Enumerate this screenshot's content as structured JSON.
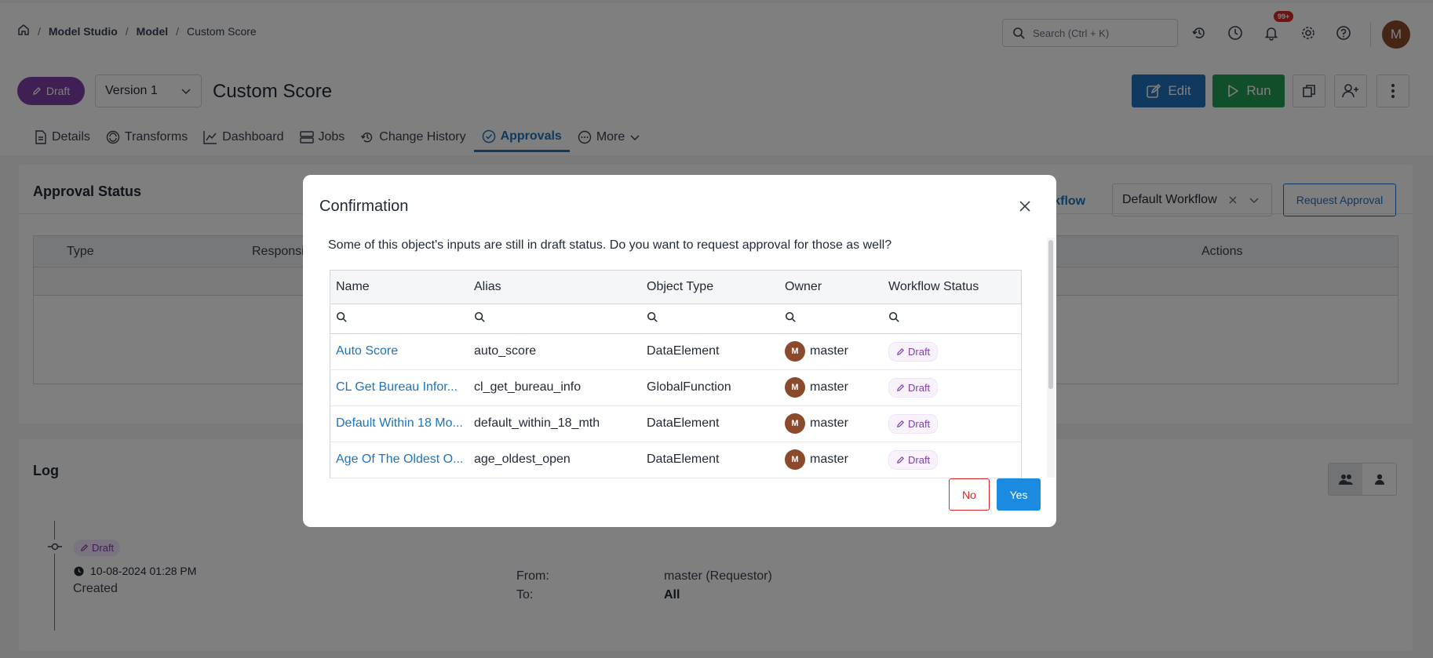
{
  "breadcrumb": {
    "home_icon": "home-icon",
    "items": [
      "Model Studio",
      "Model"
    ],
    "current": "Custom Score"
  },
  "search": {
    "placeholder": "Search (Ctrl + K)"
  },
  "notifications": {
    "badge": "99+"
  },
  "user": {
    "initial": "M"
  },
  "header": {
    "status": "Draft",
    "version": "Version 1",
    "title": "Custom Score",
    "edit_label": "Edit",
    "run_label": "Run"
  },
  "tabs": [
    {
      "label": "Details",
      "icon": "document-icon"
    },
    {
      "label": "Transforms",
      "icon": "transform-icon"
    },
    {
      "label": "Dashboard",
      "icon": "chart-icon"
    },
    {
      "label": "Jobs",
      "icon": "server-icon"
    },
    {
      "label": "Change History",
      "icon": "history-icon"
    },
    {
      "label": "Approvals",
      "icon": "check-circle-icon"
    },
    {
      "label": "More",
      "icon": "ellipsis-icon"
    }
  ],
  "approval": {
    "title": "Approval Status",
    "workflow_link": "rkflow",
    "workflow_select": "Default Workflow",
    "request_button": "Request Approval",
    "columns": {
      "type": "Type",
      "response": "Responsi",
      "actions": "Actions"
    }
  },
  "log": {
    "title": "Log",
    "status": "Draft",
    "timestamp": "10-08-2024 01:28 PM",
    "action": "Created",
    "from_label": "From:",
    "from_value": "master (Requestor)",
    "to_label": "To:",
    "to_value": "All"
  },
  "modal": {
    "title": "Confirmation",
    "message": "Some of this object's inputs are still in draft status. Do you want to request approval for those as well?",
    "columns": [
      "Name",
      "Alias",
      "Object Type",
      "Owner",
      "Workflow Status"
    ],
    "rows": [
      {
        "name": "Auto Score",
        "alias": "auto_score",
        "type": "DataElement",
        "owner": "master",
        "owner_initial": "M",
        "status": "Draft"
      },
      {
        "name": "CL Get Bureau Infor...",
        "alias": "cl_get_bureau_info",
        "type": "GlobalFunction",
        "owner": "master",
        "owner_initial": "M",
        "status": "Draft"
      },
      {
        "name": "Default Within 18 Mo...",
        "alias": "default_within_18_mth",
        "type": "DataElement",
        "owner": "master",
        "owner_initial": "M",
        "status": "Draft"
      },
      {
        "name": "Age Of The Oldest O...",
        "alias": "age_oldest_open",
        "type": "DataElement",
        "owner": "master",
        "owner_initial": "M",
        "status": "Draft"
      }
    ],
    "no_label": "No",
    "yes_label": "Yes"
  },
  "colors": {
    "accent": "#1e73be",
    "run": "#219e55",
    "draft": "#7e3ea8",
    "danger": "#dc2626",
    "confirm": "#1a8be0"
  }
}
